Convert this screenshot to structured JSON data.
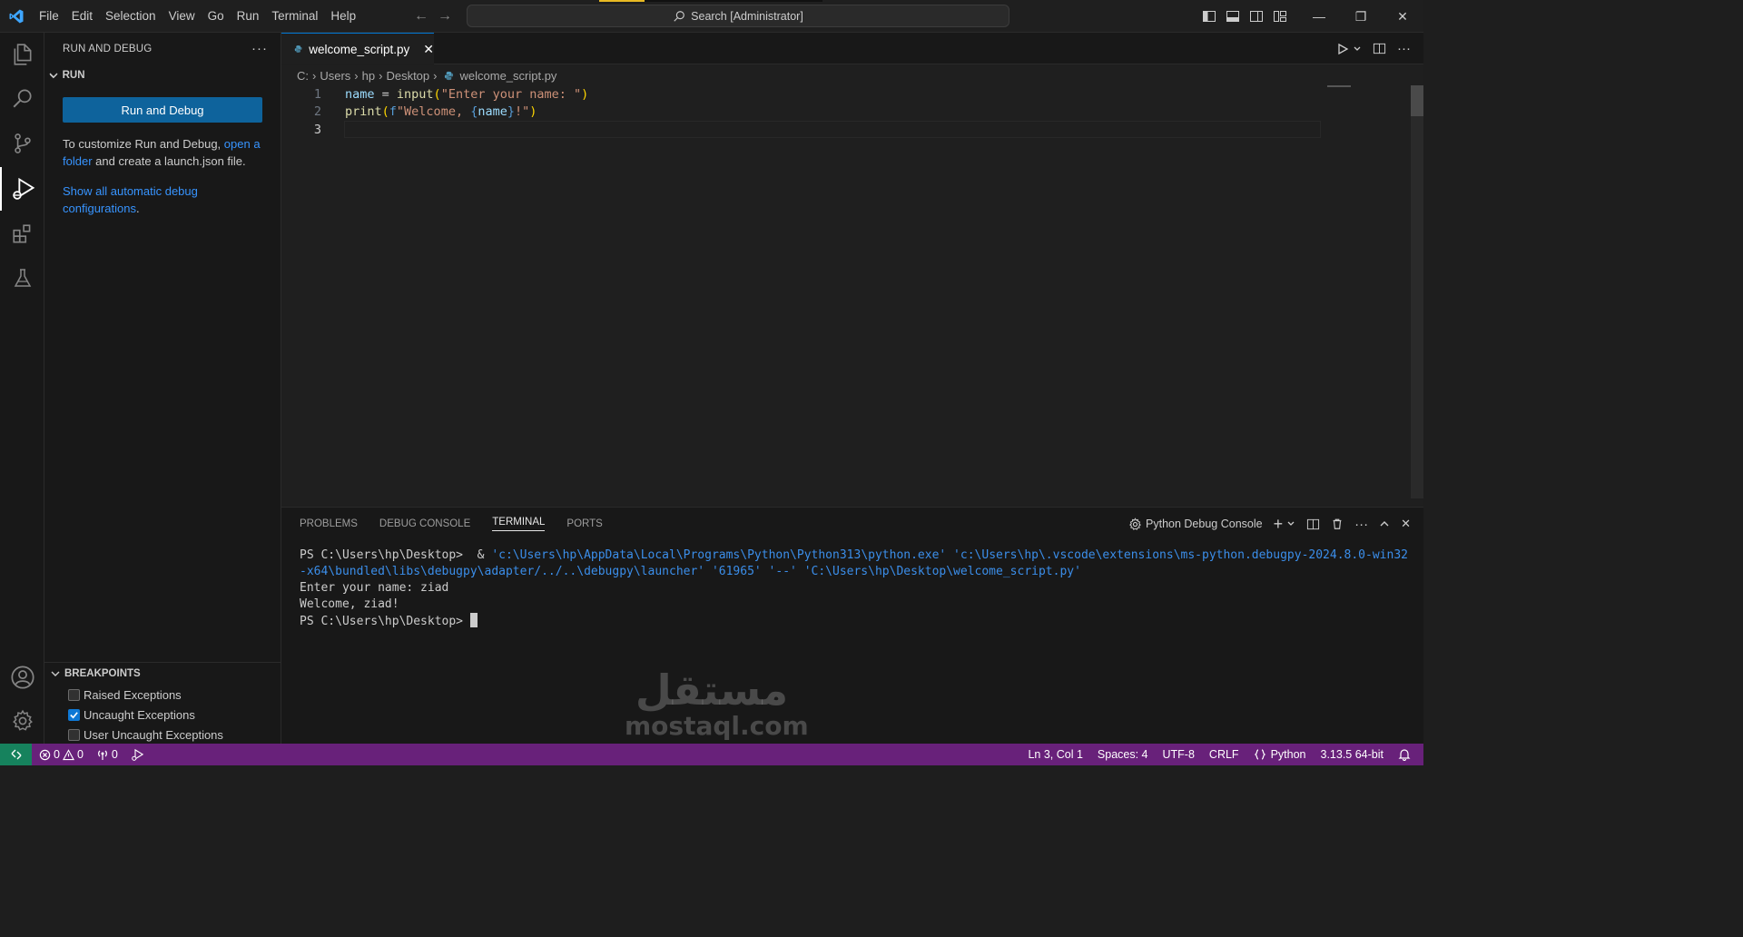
{
  "titlebar": {
    "menu": [
      "File",
      "Edit",
      "Selection",
      "View",
      "Go",
      "Run",
      "Terminal",
      "Help"
    ],
    "search_placeholder": "Search [Administrator]"
  },
  "sidebar": {
    "header": "RUN AND DEBUG",
    "run_section": "RUN",
    "run_button": "Run and Debug",
    "customize_text_1": "To customize Run and Debug, ",
    "customize_link": "open a folder",
    "customize_text_2": " and create a launch.json file.",
    "show_all_link": "Show all automatic debug configurations",
    "show_all_period": ".",
    "breakpoints_title": "BREAKPOINTS",
    "breakpoints": [
      {
        "label": "Raised Exceptions",
        "checked": false
      },
      {
        "label": "Uncaught Exceptions",
        "checked": true
      },
      {
        "label": "User Uncaught Exceptions",
        "checked": false
      }
    ]
  },
  "editor": {
    "tab_label": "welcome_script.py",
    "breadcrumb": [
      "C:",
      "Users",
      "hp",
      "Desktop",
      "welcome_script.py"
    ],
    "line_numbers": [
      "1",
      "2",
      "3"
    ]
  },
  "panel": {
    "tabs": [
      "PROBLEMS",
      "DEBUG CONSOLE",
      "TERMINAL",
      "PORTS"
    ],
    "active_tab": "TERMINAL",
    "terminal_name": "Python Debug Console",
    "terminal": {
      "prompt": "PS C:\\Users\\hp\\Desktop>",
      "command_amp": "  & ",
      "command_args": "'c:\\Users\\hp\\AppData\\Local\\Programs\\Python\\Python313\\python.exe' 'c:\\Users\\hp\\.vscode\\extensions\\ms-python.debugpy-2024.8.0-win32-x64\\bundled\\libs\\debugpy\\adapter/../..\\debugpy\\launcher' '61965' '--' 'C:\\Users\\hp\\Desktop\\welcome_script.py'",
      "line_input": "Enter your name: ziad",
      "line_output": "Welcome, ziad!",
      "final_prompt": "PS C:\\Users\\hp\\Desktop> "
    }
  },
  "watermark": {
    "arabic": "مستقل",
    "latin": "mostaql.com"
  },
  "statusbar": {
    "errors": "0",
    "warnings": "0",
    "ports": "0",
    "position": "Ln 3, Col 1",
    "spaces": "Spaces: 4",
    "encoding": "UTF-8",
    "eol": "CRLF",
    "language": "Python",
    "interpreter": "3.13.5 64-bit"
  },
  "colors": {
    "statusbar": "#68217a",
    "accent": "#0078d4",
    "button": "#0e639c"
  }
}
